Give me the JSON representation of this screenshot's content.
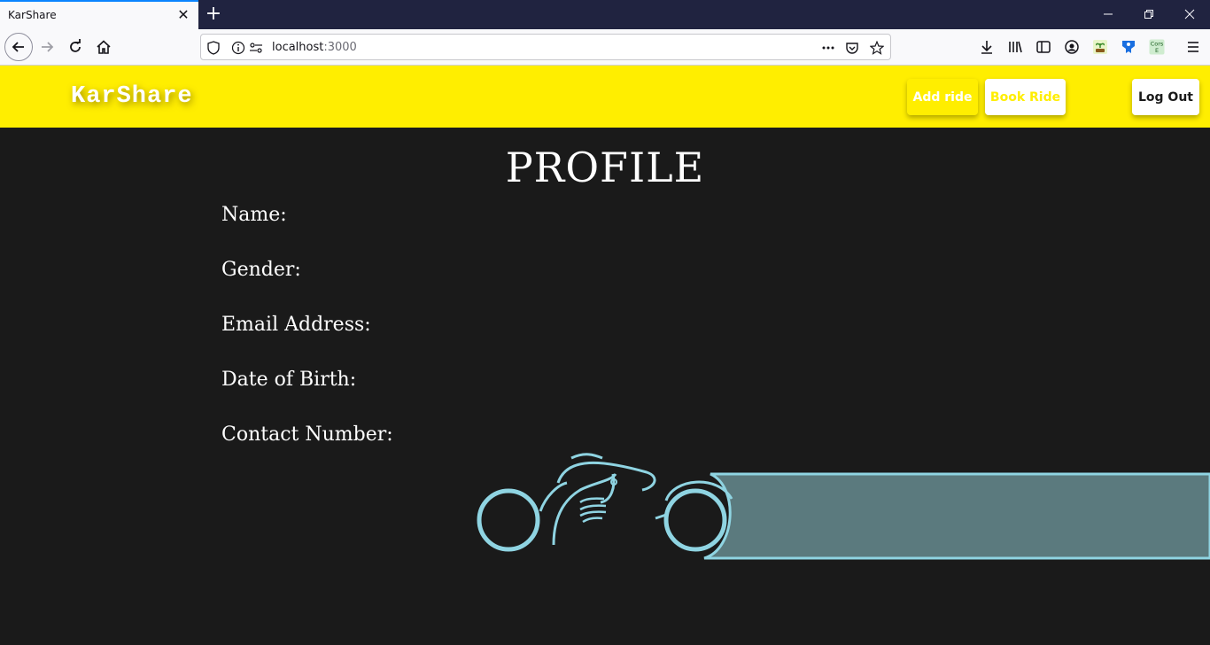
{
  "browser": {
    "tab_title": "KarShare",
    "url_host": "localhost",
    "url_port": ":3000",
    "ext_label_1": "Cors",
    "ext_label_2": "E"
  },
  "header": {
    "brand": "KarShare",
    "add_ride": "Add ride",
    "book_ride": "Book Ride",
    "log_out": "Log Out"
  },
  "profile": {
    "title": "PROFILE",
    "fields": [
      {
        "label": "Name:"
      },
      {
        "label": "Gender:"
      },
      {
        "label": "Email Address:"
      },
      {
        "label": "Date of Birth:"
      },
      {
        "label": "Contact Number:"
      }
    ]
  },
  "colors": {
    "header_bg": "#ffee00",
    "page_bg": "#1a1a1a",
    "bike_stroke": "#8fd4e2",
    "trail_fill": "#5b7a7e"
  }
}
